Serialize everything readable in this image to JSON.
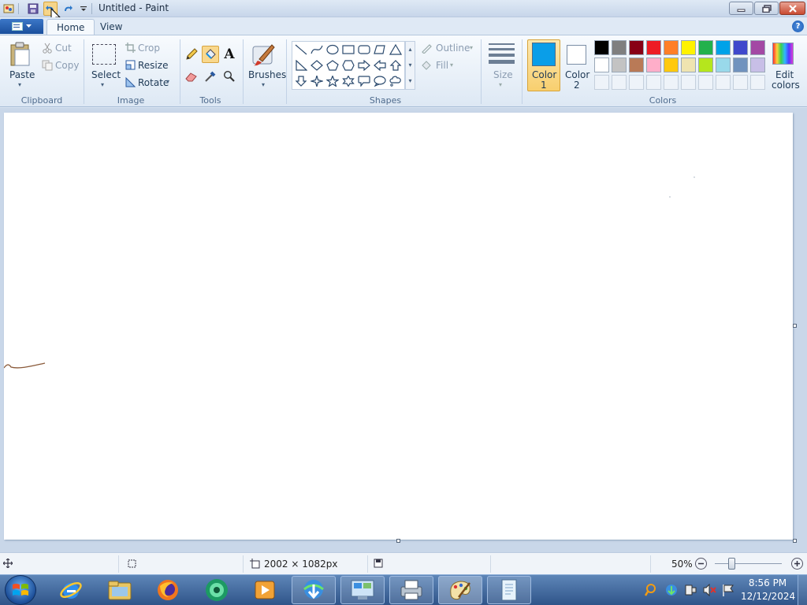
{
  "window": {
    "title": "Untitled - Paint"
  },
  "tabs": [
    {
      "label": "Home"
    },
    {
      "label": "View"
    }
  ],
  "clipboard": {
    "paste": "Paste",
    "cut": "Cut",
    "copy": "Copy",
    "group": "Clipboard"
  },
  "image": {
    "select": "Select",
    "crop": "Crop",
    "resize": "Resize",
    "rotate": "Rotate",
    "group": "Image"
  },
  "tools": {
    "group": "Tools"
  },
  "brushes": {
    "label": "Brushes"
  },
  "shapes": {
    "group": "Shapes",
    "outline": "Outline",
    "fill": "Fill"
  },
  "size": {
    "label": "Size"
  },
  "color1": {
    "label_line1": "Color",
    "label_line2": "1",
    "value": "#0a9ee8"
  },
  "color2": {
    "label_line1": "Color",
    "label_line2": "2",
    "value": "#ffffff"
  },
  "edit_colors": {
    "line1": "Edit",
    "line2": "colors"
  },
  "colors_group": "Colors",
  "palette_row1": [
    "#000000",
    "#7f7f7f",
    "#880015",
    "#ed1c24",
    "#ff7f27",
    "#fff200",
    "#22b14c",
    "#00a2e8",
    "#3f48cc",
    "#a349a4"
  ],
  "palette_row2": [
    "#ffffff",
    "#c3c3c3",
    "#b97a57",
    "#ffaec9",
    "#ffc90e",
    "#efe4b0",
    "#b5e61d",
    "#99d9ea",
    "#7092be",
    "#c8bfe7"
  ],
  "status": {
    "dimensions": "2002 × 1082px",
    "zoom": "50%"
  },
  "clock": {
    "time": "8:56 PM",
    "date": "12/12/2024"
  },
  "accent": "#3a6fb5"
}
